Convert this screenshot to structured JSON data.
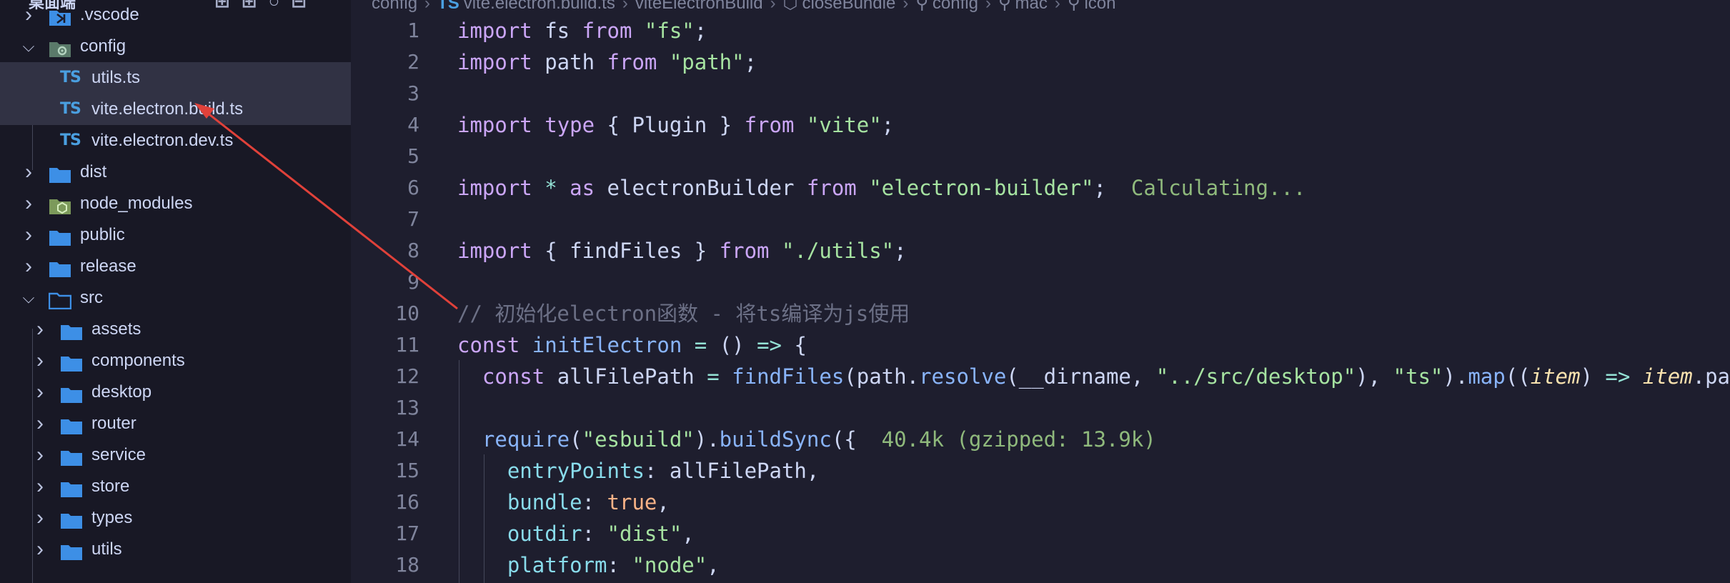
{
  "explorer": {
    "title": "桌面端",
    "actions_glyphs": "⊞⊞○⊟"
  },
  "tree": [
    {
      "label": ".vscode",
      "type": "folder-vscode",
      "expanded": false
    },
    {
      "label": "config",
      "type": "folder-config",
      "expanded": true
    },
    {
      "label": "utils.ts",
      "type": "ts-file",
      "icon_text": "TS"
    },
    {
      "label": "vite.electron.build.ts",
      "type": "ts-file",
      "icon_text": "TS"
    },
    {
      "label": "vite.electron.dev.ts",
      "type": "ts-file",
      "icon_text": "TS"
    },
    {
      "label": "dist",
      "type": "folder",
      "expanded": false
    },
    {
      "label": "node_modules",
      "type": "folder-node",
      "expanded": false
    },
    {
      "label": "public",
      "type": "folder",
      "expanded": false
    },
    {
      "label": "release",
      "type": "folder",
      "expanded": false
    },
    {
      "label": "src",
      "type": "folder-open",
      "expanded": true
    },
    {
      "label": "assets",
      "type": "folder",
      "expanded": false
    },
    {
      "label": "components",
      "type": "folder",
      "expanded": false
    },
    {
      "label": "desktop",
      "type": "folder",
      "expanded": false
    },
    {
      "label": "router",
      "type": "folder",
      "expanded": false
    },
    {
      "label": "service",
      "type": "folder",
      "expanded": false
    },
    {
      "label": "store",
      "type": "folder",
      "expanded": false
    },
    {
      "label": "types",
      "type": "folder",
      "expanded": false
    },
    {
      "label": "utils",
      "type": "folder",
      "expanded": false
    }
  ],
  "breadcrumb": {
    "items": [
      "config",
      "vite.electron.build.ts",
      "viteElectronBuild",
      "closeBundle",
      "config",
      "mac",
      "icon"
    ],
    "file_icon_text": "TS"
  },
  "editor": {
    "line_numbers": [
      "1",
      "2",
      "3",
      "4",
      "5",
      "6",
      "7",
      "8",
      "9",
      "10",
      "11",
      "12",
      "13",
      "14",
      "15",
      "16",
      "17",
      "18"
    ],
    "inline_hints": {
      "line6": "Calculating...",
      "line14": "40.4k (gzipped: 13.9k)"
    },
    "comment_line10": "// 初始化electron函数 - 将ts编译为js使用"
  },
  "colors": {
    "editor_bg": "#1e1e2e",
    "sidebar_bg": "#181825",
    "selection_bg": "#313244",
    "keyword": "#cba6f7",
    "string": "#a6e3a1",
    "function": "#89b4fa",
    "ts_icon": "#4a9fe0",
    "folder": "#3d8fe6",
    "annotation_arrow": "#e0413a"
  }
}
